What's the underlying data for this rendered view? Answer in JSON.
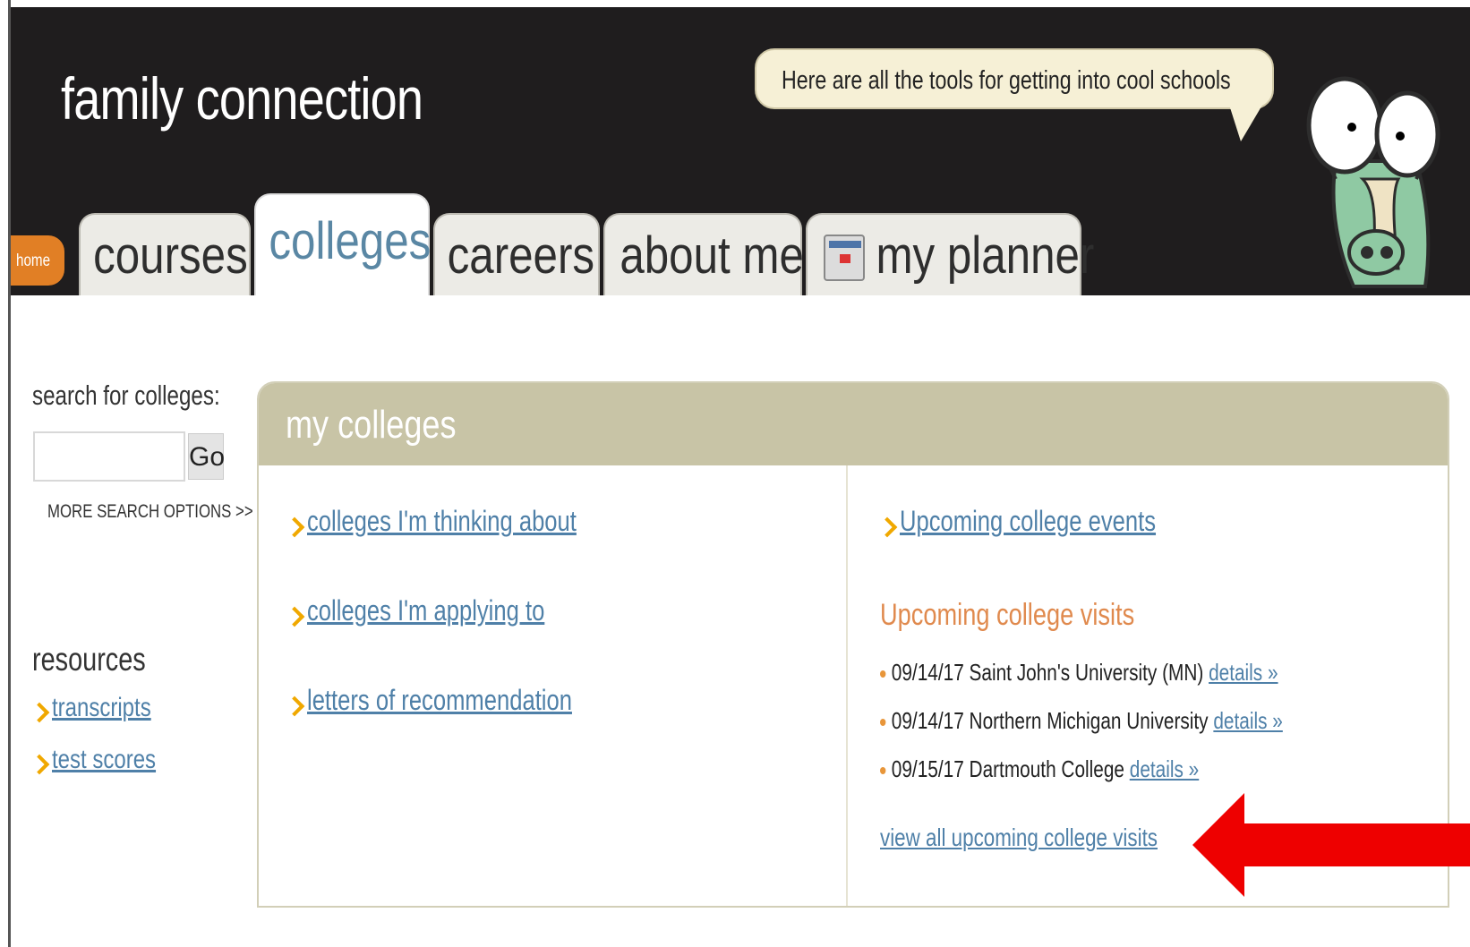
{
  "app": {
    "brand": "family connection",
    "bubble_text": "Here are all the tools for getting into cool schools"
  },
  "tabs": {
    "home": "home",
    "items": [
      {
        "label": "courses"
      },
      {
        "label": "colleges",
        "active": true
      },
      {
        "label": "careers"
      },
      {
        "label": "about me"
      },
      {
        "label": "my planner",
        "icon": "calendar-icon"
      }
    ]
  },
  "sidebar": {
    "search_label": "search for colleges:",
    "search_value": "",
    "go_label": "Go",
    "more_search": "MORE SEARCH OPTIONS >>",
    "resources_title": "resources",
    "resources": [
      "transcripts",
      "test scores"
    ]
  },
  "panel": {
    "title": "my colleges",
    "left_links": [
      "colleges I'm thinking about",
      "colleges I'm applying to",
      "letters of recommendation"
    ],
    "events_link": "Upcoming college events",
    "visits_title": "Upcoming college visits",
    "visits": [
      {
        "text": "09/14/17 Saint John's University (MN)",
        "link": "details »"
      },
      {
        "text": "09/14/17 Northern Michigan University",
        "link": "details »"
      },
      {
        "text": "09/15/17 Dartmouth College",
        "link": "details »"
      }
    ],
    "view_all": "view all upcoming college visits"
  },
  "colors": {
    "header_bg": "#1f1d1e",
    "accent_orange": "#e17f25",
    "link_blue": "#4f80a8",
    "panel_head": "#c8c4a6",
    "annotation_arrow": "#ee0000"
  }
}
